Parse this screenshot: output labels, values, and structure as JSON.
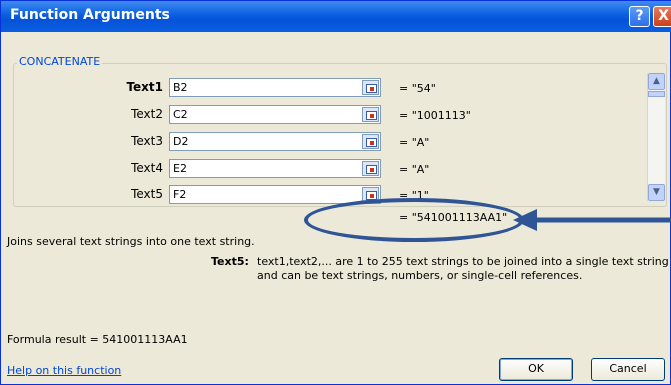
{
  "window": {
    "title": "Function Arguments",
    "help_glyph": "?",
    "close_glyph": "X"
  },
  "group": {
    "title": "CONCATENATE"
  },
  "args": [
    {
      "label": "Text1",
      "value": "B2",
      "result": "= \"54\""
    },
    {
      "label": "Text2",
      "value": "C2",
      "result": "= \"1001113\""
    },
    {
      "label": "Text3",
      "value": "D2",
      "result": "= \"A\""
    },
    {
      "label": "Text4",
      "value": "E2",
      "result": "= \"A\""
    },
    {
      "label": "Text5",
      "value": "F2",
      "result": "= \"1\""
    }
  ],
  "function_result": "= \"541001113AA1\"",
  "description": "Joins several text strings into one text string.",
  "arg_help": {
    "label": "Text5:",
    "line1": "text1,text2,... are 1 to 255 text strings to be joined into a single text string",
    "line2": "and can be text strings, numbers, or single-cell references."
  },
  "formula_result": "Formula result =   541001113AA1",
  "help_link": "Help on this function",
  "buttons": {
    "ok": "OK",
    "cancel": "Cancel"
  },
  "scroll": {
    "up_glyph": "▲",
    "down_glyph": "▼"
  },
  "annotation_color": "#2f5597"
}
